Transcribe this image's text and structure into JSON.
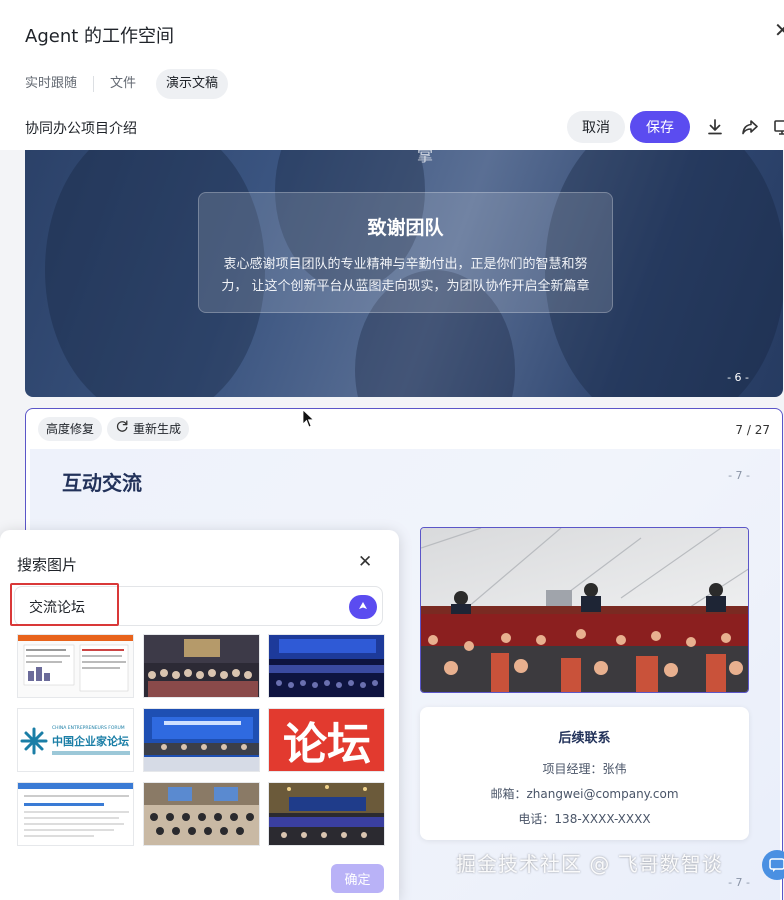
{
  "header": {
    "title": "Agent 的工作空间"
  },
  "tabs": [
    {
      "label": "实时跟随"
    },
    {
      "label": "文件"
    },
    {
      "label": "演示文稿"
    }
  ],
  "toolbar": {
    "doc_title": "协同办公项目介绍",
    "cancel_label": "取消",
    "save_label": "保存"
  },
  "slide6": {
    "glyph": "掌",
    "card_title": "致谢团队",
    "card_body": "衷心感谢项目团队的专业精神与辛勤付出，正是你们的智慧和努力， 让这个创新平台从蓝图走向现实，为团队协作开启全新篇章",
    "page": "- 6 -"
  },
  "slide7": {
    "chip_repair": "高度修复",
    "chip_regen": "重新生成",
    "counter": "7 / 27",
    "title": "互动交流",
    "page": "- 7 -",
    "page_bottom": "- 7 -",
    "contact": {
      "title": "后续联系",
      "manager": "项目经理：张伟",
      "email": "邮箱：zhangwei@company.com",
      "phone": "电话：138-XXXX-XXXX"
    }
  },
  "search": {
    "title": "搜索图片",
    "query": "交流论坛",
    "confirm_label": "确定",
    "thumb_logo_text": "中国企业家论坛",
    "thumb_logo_sub": "CHINA ENTREPRENEURS FORUM",
    "thumb_red_text": "论坛"
  },
  "watermark": "掘金技术社区 @ 飞哥数智谈",
  "colors": {
    "accent": "#5b4cf0",
    "highlight": "#d93838",
    "slide_navy": "#2b4168"
  }
}
